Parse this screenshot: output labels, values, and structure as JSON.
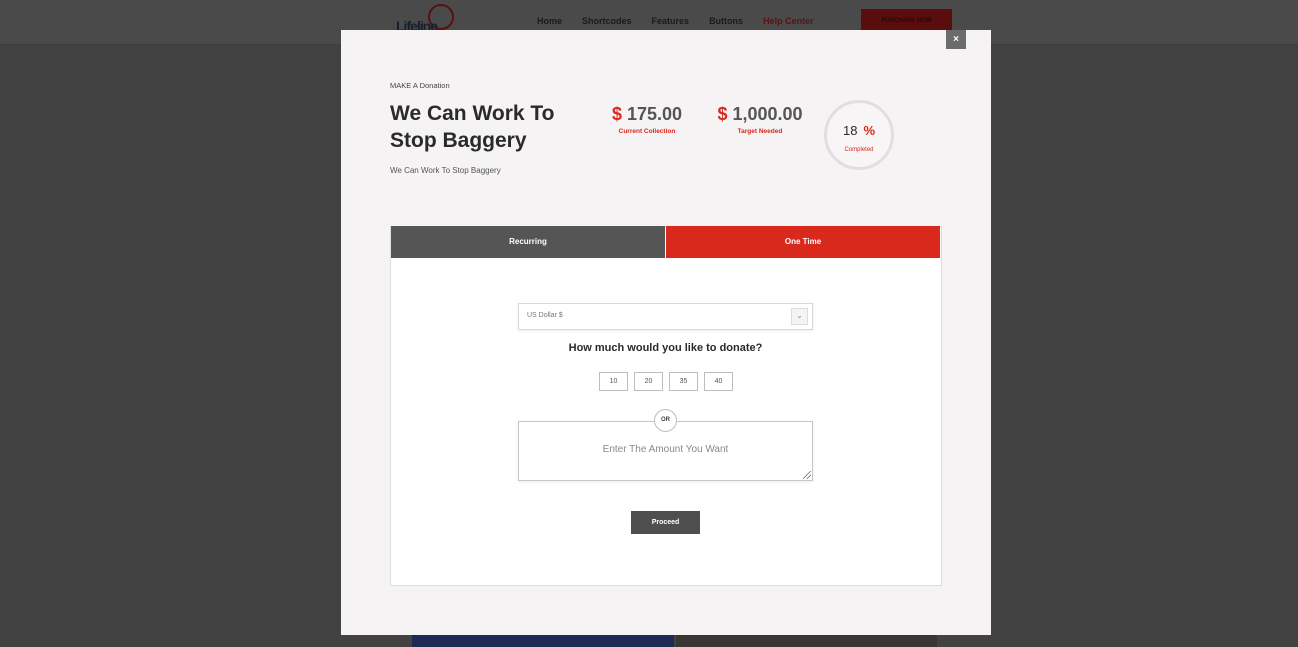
{
  "background": {
    "logo_text": "Lifeline",
    "nav": [
      "Home",
      "Shortcodes",
      "Features",
      "Buttons",
      "Help Center"
    ],
    "purchase_label": "PURCHASE NOW"
  },
  "modal": {
    "close_label": "×",
    "eyebrow": "MAKE A Donation",
    "title": "We Can Work To Stop Baggery",
    "subtitle": "We Can Work To Stop Baggery",
    "current": {
      "currency": "$",
      "amount": "175.00",
      "label": "Current Collection"
    },
    "target": {
      "currency": "$",
      "amount": "1,000.00",
      "label": "Target Needed"
    },
    "progress": {
      "value": "18",
      "symbol": "%",
      "label": "Completed"
    },
    "tabs": {
      "recurring": "Recurring",
      "one_time": "One Time",
      "active": "one_time"
    },
    "currency_select": "US Dollar $",
    "question": "How much would you like to donate?",
    "presets": [
      "10",
      "20",
      "35",
      "40"
    ],
    "or_label": "OR",
    "amount_placeholder": "Enter The Amount You Want",
    "proceed_label": "Proceed"
  },
  "colors": {
    "accent": "#d9281c",
    "dark": "#555555",
    "overlay": "#424242"
  }
}
